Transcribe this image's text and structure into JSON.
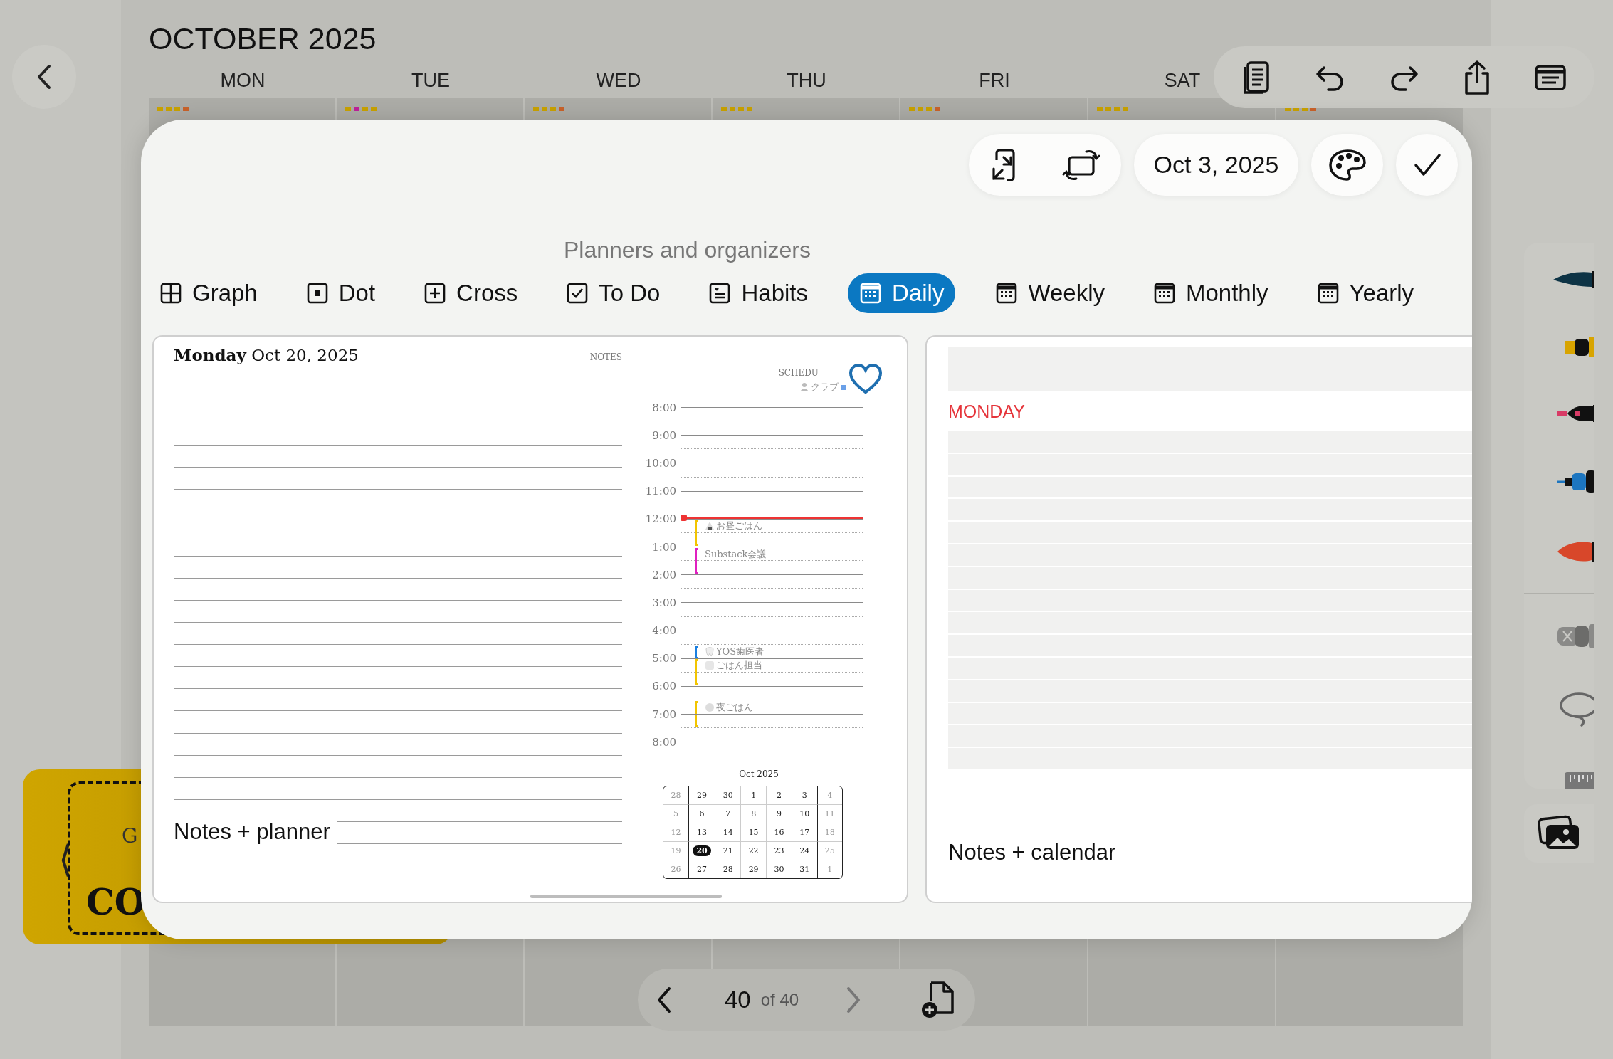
{
  "calendar": {
    "title": "OCTOBER 2025",
    "weekdays": [
      "MON",
      "TUE",
      "WED",
      "THU",
      "FRI",
      "SAT"
    ]
  },
  "cover_card": {
    "arrow": "⟨",
    "line_1": "G",
    "line_2": "CO"
  },
  "modal": {
    "date": "Oct 3, 2025",
    "section_title": "Planners and organizers",
    "tabs": [
      {
        "label": "Graph",
        "kind": "graph",
        "selected": false
      },
      {
        "label": "Dot",
        "kind": "dot",
        "selected": false
      },
      {
        "label": "Cross",
        "kind": "cross",
        "selected": false
      },
      {
        "label": "To Do",
        "kind": "todo",
        "selected": false
      },
      {
        "label": "Habits",
        "kind": "habits",
        "selected": false
      },
      {
        "label": "Daily",
        "kind": "calendar",
        "selected": true
      },
      {
        "label": "Weekly",
        "kind": "calendar",
        "selected": false
      },
      {
        "label": "Monthly",
        "kind": "calendar",
        "selected": false
      },
      {
        "label": "Yearly",
        "kind": "calendar",
        "selected": false
      }
    ],
    "templates": [
      {
        "kind": "planner",
        "caption": "Notes + planner",
        "day": "Monday",
        "date": "Oct 20, 2025",
        "notes_label": "NOTES",
        "schedule_label": "SCHEDU",
        "tag": "クラブ",
        "hours": [
          {
            "label": "8:00",
            "now": false
          },
          {
            "label": "9:00",
            "now": false
          },
          {
            "label": "10:00",
            "now": false
          },
          {
            "label": "11:00",
            "now": false
          },
          {
            "label": "12:00",
            "now": true,
            "events": [
              {
                "title": "お昼ごはん",
                "kind": "meal",
                "half_past": false,
                "short": false,
                "color": "#f2c500"
              }
            ]
          },
          {
            "label": "1:00",
            "now": false,
            "events": [
              {
                "title": "Substack会議",
                "kind": "meeting",
                "half_past": false,
                "short": false,
                "color": "#e020c0"
              }
            ]
          },
          {
            "label": "2:00",
            "now": false
          },
          {
            "label": "3:00",
            "now": false
          },
          {
            "label": "4:00",
            "now": false,
            "events": [
              {
                "title": "YOS歯医者",
                "kind": "dentist",
                "half_past": true,
                "short": true,
                "color": "#1a7fe0"
              }
            ]
          },
          {
            "label": "5:00",
            "now": false,
            "events": [
              {
                "title": "ごはん担当",
                "kind": "chore",
                "half_past": false,
                "short": false,
                "color": "#f2c500"
              }
            ]
          },
          {
            "label": "6:00",
            "now": false,
            "events": [
              {
                "title": "夜ごはん",
                "kind": "dinner",
                "half_past": true,
                "short": false,
                "color": "#f2c500"
              }
            ]
          },
          {
            "label": "7:00",
            "now": false
          },
          {
            "label": "8:00",
            "now": false
          }
        ],
        "mini_calendar": {
          "title": "Oct 2025",
          "weeks": [
            [
              {
                "d": "28",
                "selected": false
              },
              {
                "d": "29",
                "selected": false
              },
              {
                "d": "30",
                "selected": false
              },
              {
                "d": "1",
                "selected": false
              },
              {
                "d": "2",
                "selected": false
              },
              {
                "d": "3",
                "selected": false
              },
              {
                "d": "4",
                "selected": false
              }
            ],
            [
              {
                "d": "5",
                "selected": false
              },
              {
                "d": "6",
                "selected": false
              },
              {
                "d": "7",
                "selected": false
              },
              {
                "d": "8",
                "selected": false
              },
              {
                "d": "9",
                "selected": false
              },
              {
                "d": "10",
                "selected": false
              },
              {
                "d": "11",
                "selected": false
              }
            ],
            [
              {
                "d": "12",
                "selected": false
              },
              {
                "d": "13",
                "selected": false
              },
              {
                "d": "14",
                "selected": false
              },
              {
                "d": "15",
                "selected": false
              },
              {
                "d": "16",
                "selected": false
              },
              {
                "d": "17",
                "selected": false
              },
              {
                "d": "18",
                "selected": false
              }
            ],
            [
              {
                "d": "19",
                "selected": false
              },
              {
                "d": "20",
                "selected": true
              },
              {
                "d": "21",
                "selected": false
              },
              {
                "d": "22",
                "selected": false
              },
              {
                "d": "23",
                "selected": false
              },
              {
                "d": "24",
                "selected": false
              },
              {
                "d": "25",
                "selected": false
              }
            ],
            [
              {
                "d": "26",
                "selected": false
              },
              {
                "d": "27",
                "selected": false
              },
              {
                "d": "28",
                "selected": false
              },
              {
                "d": "29",
                "selected": false
              },
              {
                "d": "30",
                "selected": false
              },
              {
                "d": "31",
                "selected": false
              },
              {
                "d": "1",
                "selected": false
              }
            ]
          ]
        }
      },
      {
        "kind": "calendar",
        "caption": "Notes + calendar",
        "day": "MONDAY"
      }
    ]
  },
  "pager": {
    "page": "40",
    "total": "of 40"
  }
}
